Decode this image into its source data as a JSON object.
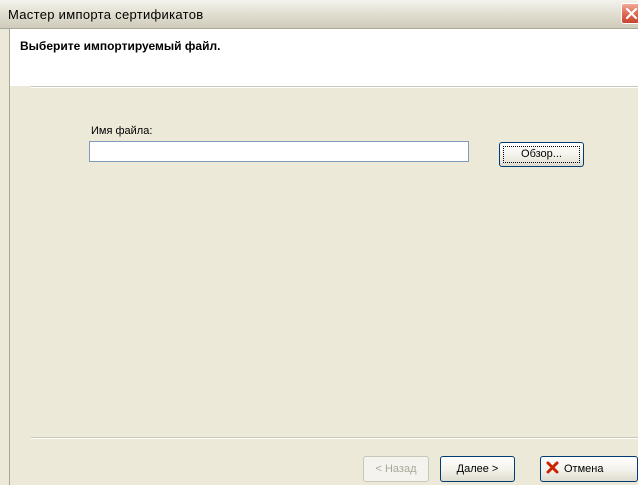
{
  "window": {
    "title": "Мастер импорта сертификатов",
    "close_icon": "close-icon"
  },
  "header": {
    "heading": "Выберите импортируемый файл."
  },
  "file": {
    "label": "Имя файла:",
    "value": "",
    "browse_label": "Обзор..."
  },
  "footer": {
    "back_label": "< Назад",
    "next_label": "Далее >",
    "cancel_label": "Отмена",
    "cancel_icon": "red-x-icon"
  },
  "colors": {
    "titlebar": "#e3e0d2",
    "dialog_bg": "#ece9d8",
    "close_button": "#e0705a",
    "button_border": "#003c74",
    "input_border": "#7f9db9",
    "cancel_icon": "#cc2200"
  }
}
